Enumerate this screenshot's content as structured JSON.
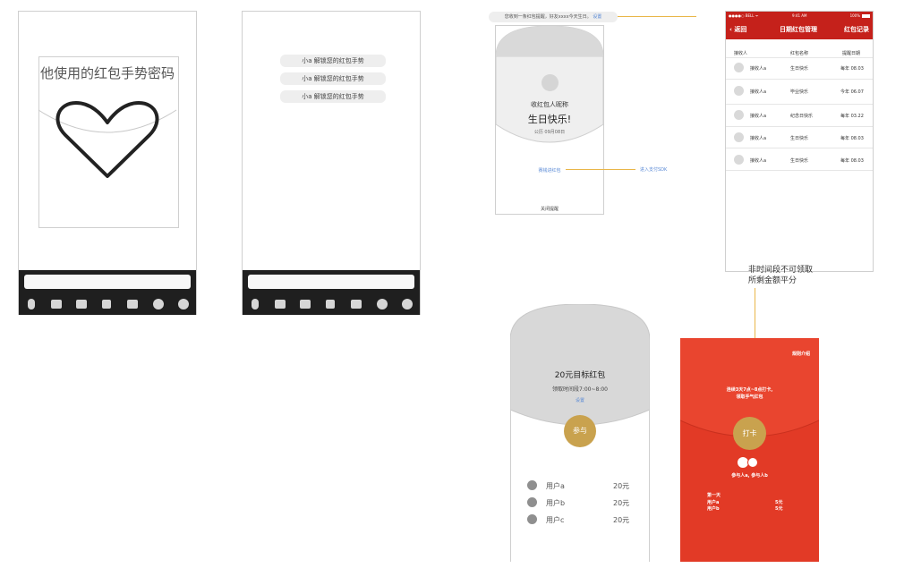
{
  "colors": {
    "brand_red": "#c5211b",
    "packet_red": "#e23a26",
    "gold": "#c9a24e",
    "link_blue": "#5a8ad6",
    "light_gray": "#d9d9d9",
    "toolbar_dark": "#1f1f1f"
  },
  "screen1": {
    "title": "他使用的红包手势密码",
    "toolbar_icons": [
      "mic-icon",
      "image-icon",
      "camera-icon",
      "file-icon",
      "gif-icon",
      "emoji-icon",
      "plus-icon"
    ]
  },
  "screen2": {
    "pills": [
      "小a 解锁您的红包手势",
      "小a 解锁您的红包手势",
      "小a 解锁您的红包手势"
    ]
  },
  "screen3": {
    "notification": "您收到一条红包提醒，好友xxxx今天生日。",
    "notification_link": "设置",
    "recipient_label": "收红包人昵称",
    "greeting": "生日快乐!",
    "date": "公历 09月08日",
    "send_link": "赛钱进红包",
    "sdk_link": "进入支付SDK",
    "close": "关闭提醒"
  },
  "screen4": {
    "status": {
      "carrier": "●●●●○ BELL ᯤ",
      "time": "9:41 AM",
      "battery": "100%"
    },
    "nav": {
      "back": "返回",
      "title": "日期红包管理",
      "right": "红包记录"
    },
    "columns": [
      "接收人",
      "红包名称",
      "提醒日期"
    ],
    "rows": [
      [
        "接收人a",
        "生日快乐",
        "每年 08.03"
      ],
      [
        "接收人a",
        "毕业快乐",
        "今年 06.07"
      ],
      [
        "接收人a",
        "纪念日快乐",
        "每年 03.22"
      ],
      [
        "接收人a",
        "生日快乐",
        "每年 08.03"
      ],
      [
        "接收人a",
        "生日快乐",
        "每年 08.03"
      ]
    ],
    "note_line1": "非时间段不可领取",
    "note_line2": "所剩金额平分"
  },
  "screen5": {
    "title": "20元目标红包",
    "period": "领取时间段7:00~8:00",
    "setting": "设置",
    "join": "参与",
    "users": [
      {
        "name": "用户a",
        "amount": "20元"
      },
      {
        "name": "用户b",
        "amount": "20元"
      },
      {
        "name": "用户c",
        "amount": "20元"
      }
    ]
  },
  "screen6": {
    "rules": "规则介绍",
    "desc_line1": "连续3天7点~8点打卡,",
    "desc_line2": "领取手气红包",
    "checkin": "打卡",
    "participants": "参与人a, 参与人b",
    "day": "第一天",
    "results": [
      {
        "name": "用户a",
        "amount": "5元"
      },
      {
        "name": "用户b",
        "amount": "5元"
      }
    ]
  }
}
